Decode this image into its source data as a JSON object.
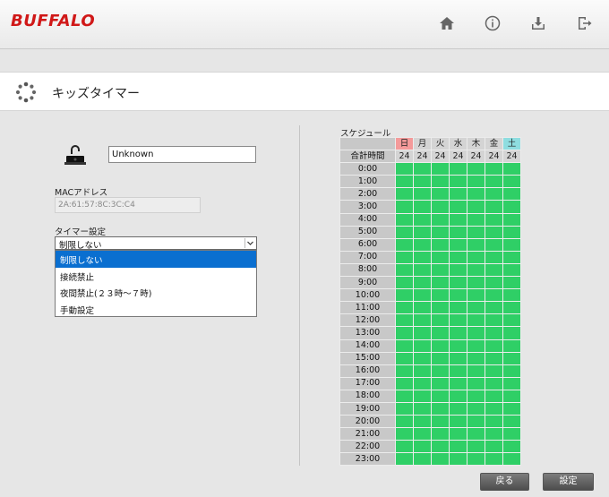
{
  "header": {
    "logo": "BUFFALO",
    "icons": [
      "home-icon",
      "info-icon",
      "download-icon",
      "logout-icon"
    ]
  },
  "page": {
    "title": "キッズタイマー"
  },
  "device": {
    "name": "Unknown",
    "mac_label": "MACアドレス",
    "mac_value": "2A:61:57:8C:3C:C4"
  },
  "timer": {
    "label": "タイマー設定",
    "selected": "制限しない",
    "options": [
      "制限しない",
      "接続禁止",
      "夜間禁止(２３時～７時)",
      "手動設定"
    ]
  },
  "schedule": {
    "label": "スケジュール",
    "days": [
      "日",
      "月",
      "火",
      "水",
      "木",
      "金",
      "土"
    ],
    "total_label": "合計時間",
    "totals": [
      "24",
      "24",
      "24",
      "24",
      "24",
      "24",
      "24"
    ],
    "hours": [
      "0:00",
      "1:00",
      "2:00",
      "3:00",
      "4:00",
      "5:00",
      "6:00",
      "7:00",
      "8:00",
      "9:00",
      "10:00",
      "11:00",
      "12:00",
      "13:00",
      "14:00",
      "15:00",
      "16:00",
      "17:00",
      "18:00",
      "19:00",
      "20:00",
      "21:00",
      "22:00",
      "23:00"
    ],
    "allowed_color": "#2fcf66",
    "sunday_color": "#f49a9a",
    "saturday_color": "#8edde0"
  },
  "buttons": {
    "back": "戻る",
    "save": "設定"
  }
}
